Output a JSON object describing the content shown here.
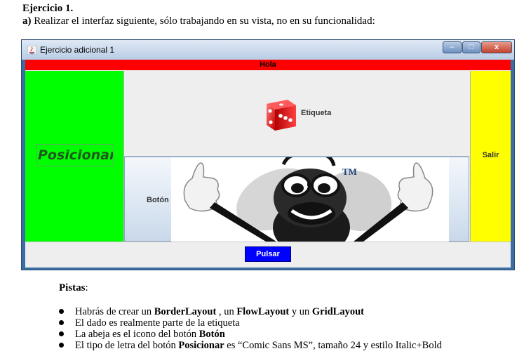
{
  "document": {
    "heading": "Ejercicio 1.",
    "task_letter": "a)",
    "task_text": "Realizar el interfaz siguiente, sólo trabajando en su vista, no en su funcionalidad:"
  },
  "window": {
    "title": "Ejercicio adicional 1",
    "controls": {
      "minimize": "–",
      "maximize": "□",
      "close": "x"
    },
    "north_label": "Hola",
    "west_button": "Posicionar",
    "east_button": "Salir",
    "center_label": "Etiqueta",
    "center_button": "Botón",
    "bee_tm": "TM",
    "south_button": "Pulsar"
  },
  "hints": {
    "title": "Pistas",
    "items": [
      {
        "pre": "Habrás de crear  un ",
        "b1": "BorderLayout",
        "mid1": " , un ",
        "b2": "FlowLayout",
        "mid2": " y un ",
        "b3": "GridLayout"
      },
      {
        "pre": "El dado es realmente parte de la etiqueta"
      },
      {
        "pre": "La abeja es el icono del botón ",
        "b1": "Botón"
      },
      {
        "pre": "El tipo de letra del botón ",
        "b1": "Posicionar",
        "mid1": " es “Comic Sans MS”, tamaño 24 y estilo Italic+Bold"
      }
    ]
  },
  "colors": {
    "north": "#ff0000",
    "west": "#00ff00",
    "east": "#ffff00",
    "south_button": "#0000ff"
  },
  "icons": [
    "java-icon",
    "dice-icon",
    "bee-icon"
  ]
}
